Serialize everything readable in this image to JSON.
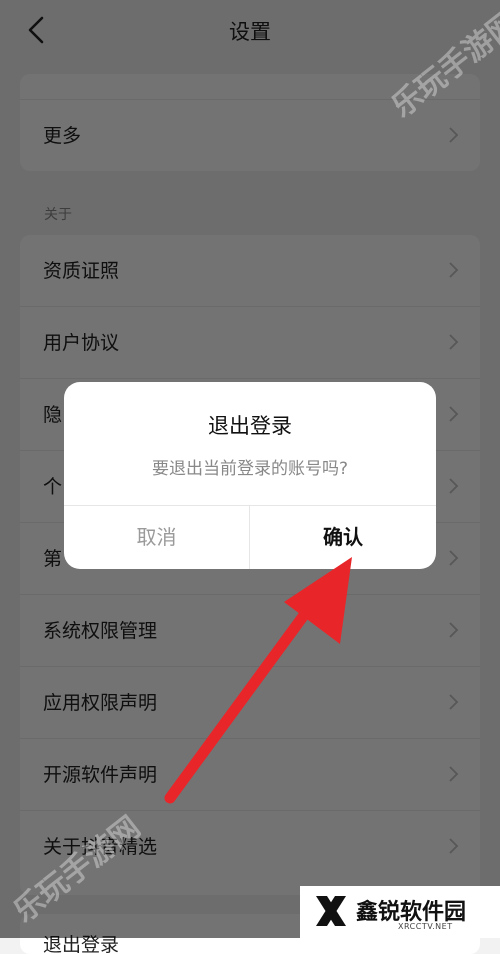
{
  "header": {
    "title": "设置"
  },
  "settings": {
    "partial_top_row": "",
    "more": "更多",
    "section_about": "关于",
    "about_items": [
      {
        "label": "资质证照"
      },
      {
        "label": "用户协议"
      },
      {
        "label": "隐"
      },
      {
        "label": "个"
      },
      {
        "label": "第"
      },
      {
        "label": "系统权限管理"
      },
      {
        "label": "应用权限声明"
      },
      {
        "label": "开源软件声明"
      },
      {
        "label": "关于抖音精选"
      }
    ],
    "bottom_partial": "退出登录"
  },
  "dialog": {
    "title": "退出登录",
    "message": "要退出当前登录的账号吗?",
    "cancel": "取消",
    "confirm": "确认"
  },
  "watermark": {
    "text": "乐玩手游网"
  },
  "logo": {
    "name": "鑫锐软件园",
    "domain": "XRCCTV.NET"
  },
  "colors": {
    "annotation_arrow": "#e8262a",
    "overlay": "rgba(0,0,0,0.55)"
  }
}
